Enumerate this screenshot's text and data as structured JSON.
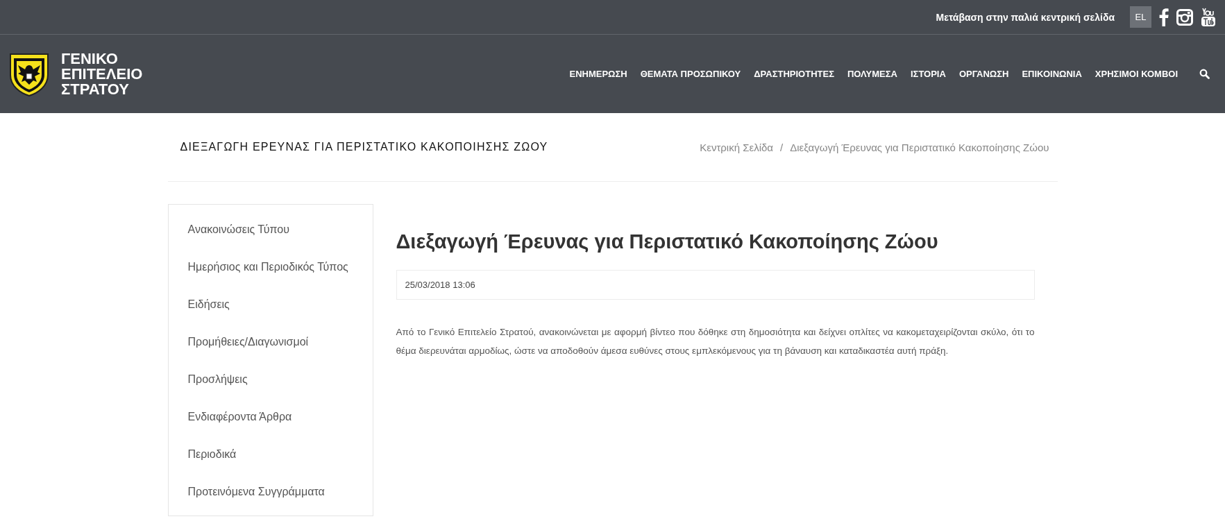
{
  "top_bar": {
    "old_home_link": "Μετάβαση στην παλιά κεντρική σελίδα",
    "language": "EL"
  },
  "header": {
    "logo_text": [
      "ΓΕΝΙΚΟ",
      "ΕΠΙΤΕΛΕΙΟ",
      "ΣΤΡΑΤΟΥ"
    ],
    "nav": [
      "ΕΝΗΜΕΡΩΣΗ",
      "ΘΕΜΑΤΑ ΠΡΟΣΩΠΙΚΟΥ",
      "ΔΡΑΣΤΗΡΙΟΤΗΤΕΣ",
      "ΠΟΛΥΜΕΣΑ",
      "ΙΣΤΟΡΙΑ",
      "ΟΡΓΑΝΩΣΗ",
      "ΕΠΙΚΟΙΝΩΝΙΑ",
      "ΧΡΗΣΙΜΟΙ ΚΟΜΒΟΙ"
    ]
  },
  "page_title": "ΔΙΕΞΑΓΩΓΗ ΕΡΕΥΝΑΣ ΓΙΑ ΠΕΡΙΣΤΑΤΙΚΟ ΚΑΚΟΠΟΙΗΣΗΣ ΖΩΟΥ",
  "breadcrumb": [
    "Κεντρική Σελίδα",
    "Διεξαγωγή Έρευνας για Περιστατικό Κακοποίησης Ζώου"
  ],
  "breadcrumb_separator": "/",
  "sidebar": {
    "items": [
      "Ανακοινώσεις Τύπου",
      "Ημερήσιος και Περιοδικός Τύπος",
      "Ειδήσεις",
      "Προμήθειες/Διαγωνισμοί",
      "Προσλήψεις",
      "Ενδιαφέροντα Άρθρα",
      "Περιοδικά",
      "Προτεινόμενα Συγγράμματα"
    ]
  },
  "article": {
    "title": "Διεξαγωγή Έρευνας για Περιστατικό Κακοποίησης Ζώου",
    "date": "25/03/2018 13:06",
    "body": "Από το Γενικό Επιτελείο Στρατού, ανακοινώνεται με αφορμή βίντεο που δόθηκε στη δημοσιότητα και δείχνει οπλίτες να κακομεταχειρίζονται σκύλο, ότι το θέμα διερευνάται αρμοδίως, ώστε να αποδοθούν άμεσα ευθύνες στους εμπλεκόμενους για τη βάναυση και καταδικαστέα αυτή πράξη."
  }
}
